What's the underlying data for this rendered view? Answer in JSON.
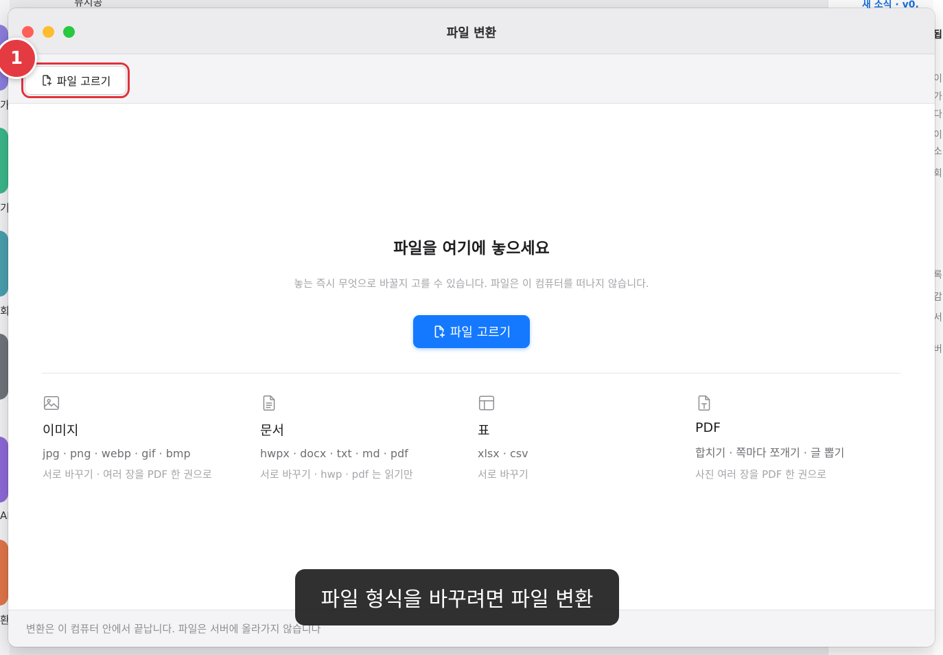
{
  "background": {
    "top_text": "뮤지콩",
    "right_link": "새 소식 · v0.",
    "left_chars": [
      "가",
      "기",
      "회",
      "AI",
      "환"
    ],
    "right_chars": [
      "됩",
      "이",
      "가",
      "다",
      "이",
      "소",
      "회",
      "록",
      "감",
      "서",
      "버"
    ]
  },
  "window": {
    "title": "파일 변환"
  },
  "toolbar": {
    "choose_label": "파일 고르기",
    "step_number": "1"
  },
  "dropzone": {
    "title": "파일을 여기에 놓으세요",
    "subtitle": "놓는 즉시 무엇으로 바꿀지 고를 수 있습니다. 파일은 이 컴퓨터를 떠나지 않습니다.",
    "button_label": "파일 고르기"
  },
  "categories": [
    {
      "icon": "image-icon",
      "name": "이미지",
      "formats": "jpg · png · webp · gif · bmp",
      "note": "서로 바꾸기 · 여러 장을 PDF 한 권으로"
    },
    {
      "icon": "document-icon",
      "name": "문서",
      "formats": "hwpx · docx · txt · md · pdf",
      "note": "서로 바꾸기 · hwp · pdf 는 읽기만"
    },
    {
      "icon": "table-icon",
      "name": "표",
      "formats": "xlsx · csv",
      "note": "서로 바꾸기"
    },
    {
      "icon": "pdf-icon",
      "name": "PDF",
      "formats": "합치기 · 쪽마다 쪼개기 · 글 뽑기",
      "note": "사진 여러 장을 PDF 한 권으로"
    }
  ],
  "footer": {
    "text": "변환은 이 컴퓨터 안에서 끝납니다. 파일은 서버에 올라가지 않습니다"
  },
  "toast": {
    "text": "파일 형식을 바꾸려면 파일 변환"
  },
  "colors": {
    "accent": "#1479ff",
    "highlight": "#e0323c",
    "traffic_red": "#fe5f57",
    "traffic_yellow": "#febc2e",
    "traffic_green": "#28c840"
  }
}
